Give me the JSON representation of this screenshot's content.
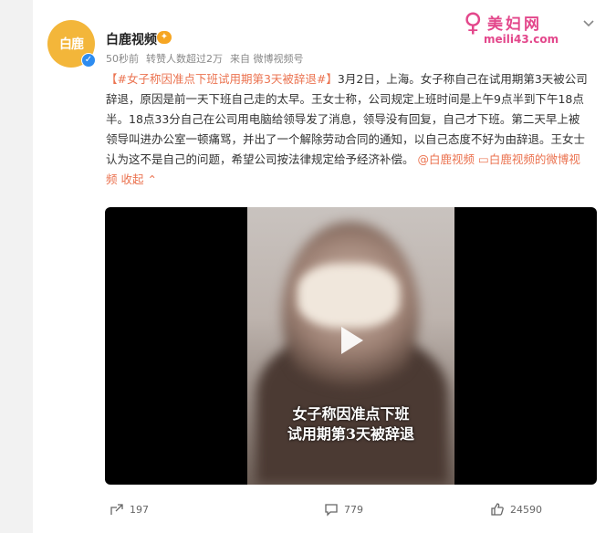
{
  "author": {
    "avatar_text": "白鹿",
    "name": "白鹿视频",
    "badge": "✦",
    "verified_mark": "✓"
  },
  "meta": {
    "time": "50秒前",
    "reposts": "转赞人数超过2万",
    "source": "来自 微博视频号"
  },
  "watermark": {
    "title": "美妇网",
    "url": "meili43.com",
    "logo": "♀"
  },
  "post": {
    "hashtag": "【#女子称因准点下班试用期第3天被辞退#】",
    "body": "3月2日，上海。女子称自己在试用期第3天被公司辞退，原因是前一天下班自己走的太早。王女士称，公司规定上班时间是上午9点半到下午18点半。18点33分自己在公司用电脑给领导发了消息，领导没有回复，自己才下班。第二天早上被领导叫进办公室一顿痛骂，并出了一个解除劳动合同的通知，以自己态度不好为由辞退。王女士认为这不是自己的问题，希望公司按法律规定给予经济补偿。",
    "mention": "@白鹿视频",
    "video_link": "白鹿视频的微博视频",
    "collapse": "收起"
  },
  "video": {
    "caption_line1": "女子称因准点下班",
    "caption_line2": "试用期第3天被辞退"
  },
  "actions": {
    "share_count": "197",
    "comment_count": "779",
    "like_count": "24590"
  },
  "icons": [
    "chevron-down-icon",
    "play-icon",
    "share-icon",
    "comment-icon",
    "like-icon"
  ],
  "colors": {
    "link": "#eb7350",
    "watermark": "#e3478b",
    "verified": "#2d8cf0"
  }
}
